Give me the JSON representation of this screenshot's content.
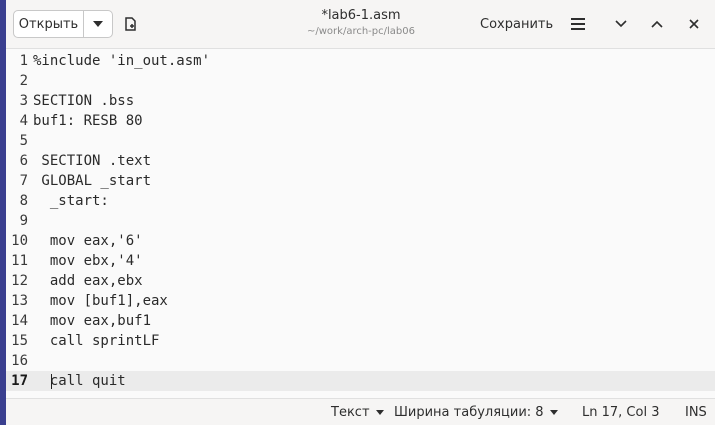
{
  "header": {
    "open_label": "Открыть",
    "title": "*lab6-1.asm",
    "subtitle": "~/work/arch-pc/lab06",
    "save_label": "Сохранить"
  },
  "editor": {
    "lines": [
      {
        "num": "1",
        "text": "%include 'in_out.asm'"
      },
      {
        "num": "2",
        "text": ""
      },
      {
        "num": "3",
        "text": "SECTION .bss"
      },
      {
        "num": "4",
        "text": "buf1: RESB 80"
      },
      {
        "num": "5",
        "text": ""
      },
      {
        "num": "6",
        "text": " SECTION .text"
      },
      {
        "num": "7",
        "text": " GLOBAL _start"
      },
      {
        "num": "8",
        "text": "  _start:"
      },
      {
        "num": "9",
        "text": ""
      },
      {
        "num": "10",
        "text": "  mov eax,'6'"
      },
      {
        "num": "11",
        "text": "  mov ebx,'4'"
      },
      {
        "num": "12",
        "text": "  add eax,ebx"
      },
      {
        "num": "13",
        "text": "  mov [buf1],eax"
      },
      {
        "num": "14",
        "text": "  mov eax,buf1"
      },
      {
        "num": "15",
        "text": "  call sprintLF"
      },
      {
        "num": "16",
        "text": ""
      },
      {
        "num": "17",
        "text": "  call quit"
      }
    ],
    "current_line": "17"
  },
  "statusbar": {
    "syntax": "Текст",
    "tab_width": "Ширина табуляции: 8",
    "position": "Ln 17, Col 3",
    "mode": "INS"
  },
  "icons": {
    "open_dropdown": "chevron-down-icon",
    "new_document": "new-document-icon",
    "menu": "hamburger-menu-icon",
    "minimize": "chevron-down-icon",
    "maximize": "chevron-up-icon",
    "close": "close-icon"
  }
}
